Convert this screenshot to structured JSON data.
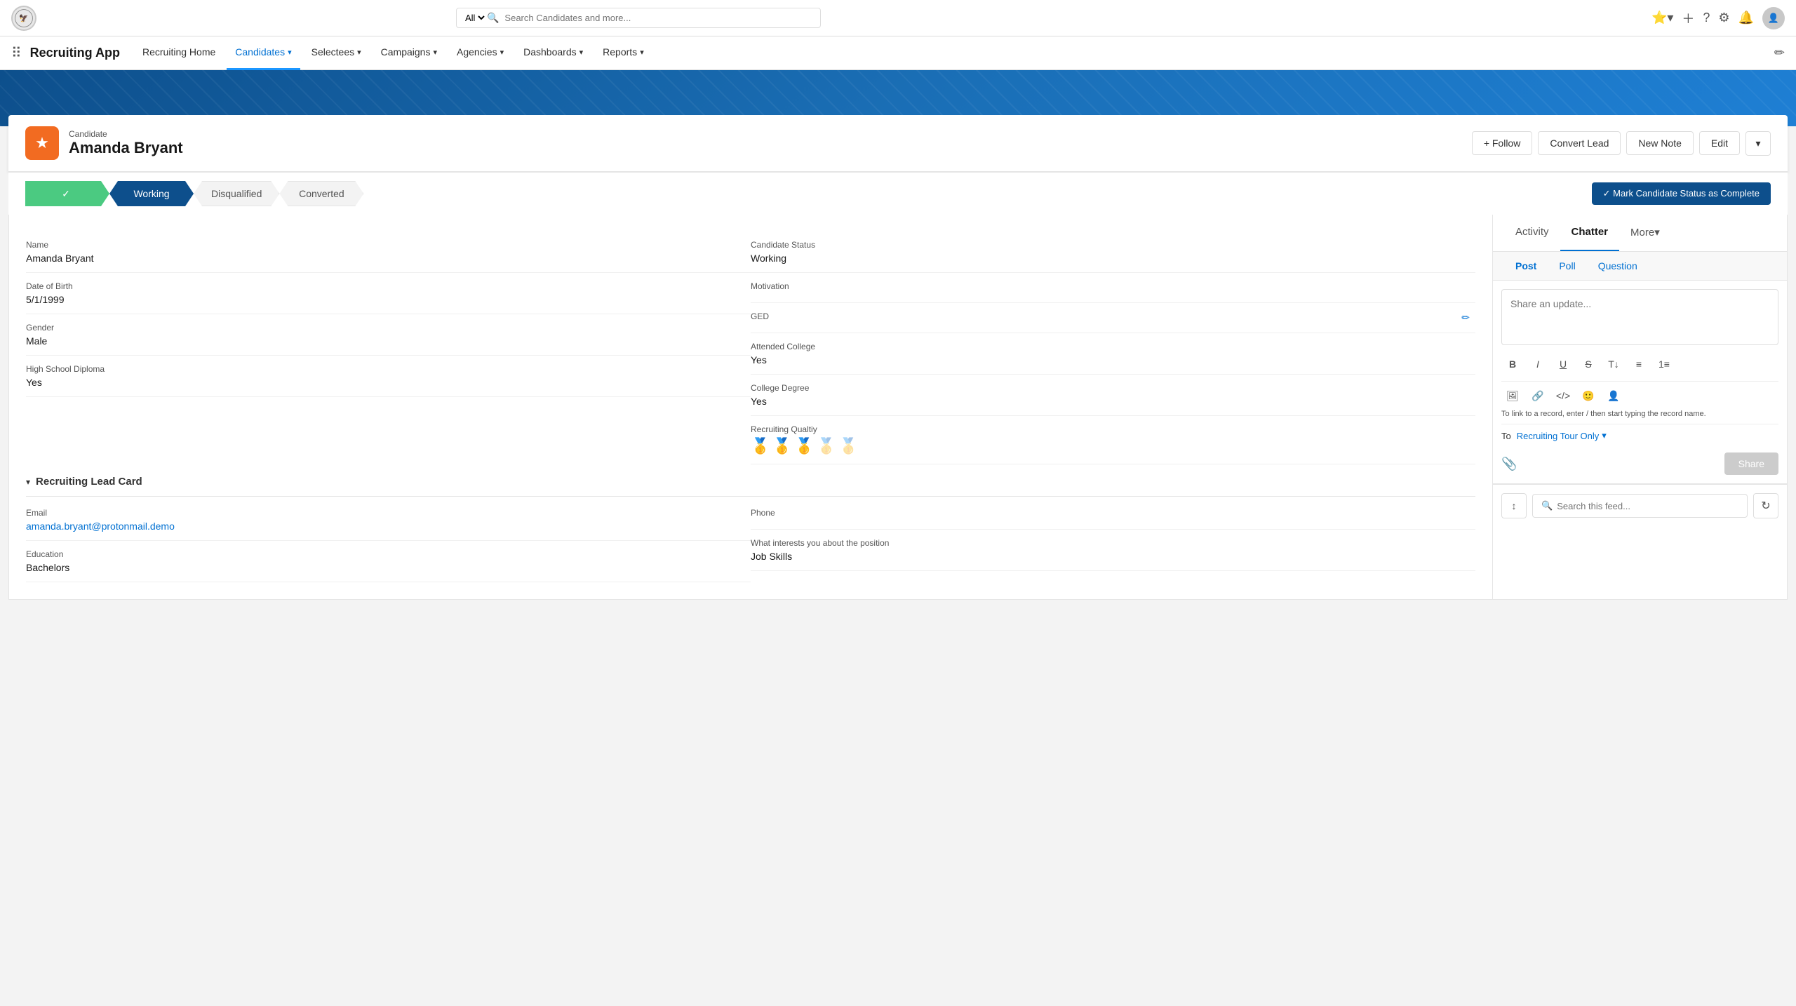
{
  "topNav": {
    "searchPlaceholder": "Search Candidates and more...",
    "searchAll": "All"
  },
  "appNav": {
    "appName": "Recruiting App",
    "items": [
      {
        "label": "Recruiting Home",
        "hasChevron": false,
        "active": false
      },
      {
        "label": "Candidates",
        "hasChevron": true,
        "active": true
      },
      {
        "label": "Selectees",
        "hasChevron": true,
        "active": false
      },
      {
        "label": "Campaigns",
        "hasChevron": true,
        "active": false
      },
      {
        "label": "Agencies",
        "hasChevron": true,
        "active": false
      },
      {
        "label": "Dashboards",
        "hasChevron": true,
        "active": false
      },
      {
        "label": "Reports",
        "hasChevron": true,
        "active": false
      }
    ]
  },
  "record": {
    "type": "Candidate",
    "name": "Amanda Bryant",
    "actions": {
      "follow": "+ Follow",
      "convertLead": "Convert Lead",
      "newNote": "New Note",
      "edit": "Edit"
    }
  },
  "statusBar": {
    "steps": [
      {
        "label": "✓",
        "state": "completed"
      },
      {
        "label": "Working",
        "state": "active"
      },
      {
        "label": "Disqualified",
        "state": "inactive"
      },
      {
        "label": "Converted",
        "state": "inactive"
      }
    ],
    "markCompleteLabel": "✓ Mark Candidate Status as Complete"
  },
  "fields": {
    "left": [
      {
        "label": "Name",
        "value": "Amanda Bryant"
      },
      {
        "label": "Date of Birth",
        "value": "5/1/1999"
      },
      {
        "label": "Gender",
        "value": "Male"
      },
      {
        "label": "High School Diploma",
        "value": "Yes"
      }
    ],
    "right": [
      {
        "label": "Candidate Status",
        "value": "Working"
      },
      {
        "label": "Motivation",
        "value": ""
      },
      {
        "label": "GED",
        "value": ""
      },
      {
        "label": "Attended College",
        "value": "Yes"
      },
      {
        "label": "College Degree",
        "value": "Yes"
      },
      {
        "label": "Recruiting Qualtiy",
        "value": "medals"
      }
    ]
  },
  "recruitingLeadCard": {
    "sectionTitle": "Recruiting Lead Card",
    "fields": {
      "left": [
        {
          "label": "Email",
          "value": "amanda.bryant@protonmail.demo",
          "isLink": true
        },
        {
          "label": "Education",
          "value": "Bachelors"
        }
      ],
      "right": [
        {
          "label": "Phone",
          "value": ""
        },
        {
          "label": "What interests you about the position",
          "value": "Job Skills"
        }
      ]
    }
  },
  "chatter": {
    "tabs": [
      "Activity",
      "Chatter",
      "More▾"
    ],
    "postTabs": [
      "Post",
      "Poll",
      "Question"
    ],
    "textarea": "Share an update...",
    "hint": "To link to a record, enter / then start typing the record name.",
    "toLabel": "To",
    "toValue": "Recruiting Tour Only",
    "shareLabel": "Share",
    "feed": {
      "searchPlaceholder": "Search this feed..."
    }
  }
}
